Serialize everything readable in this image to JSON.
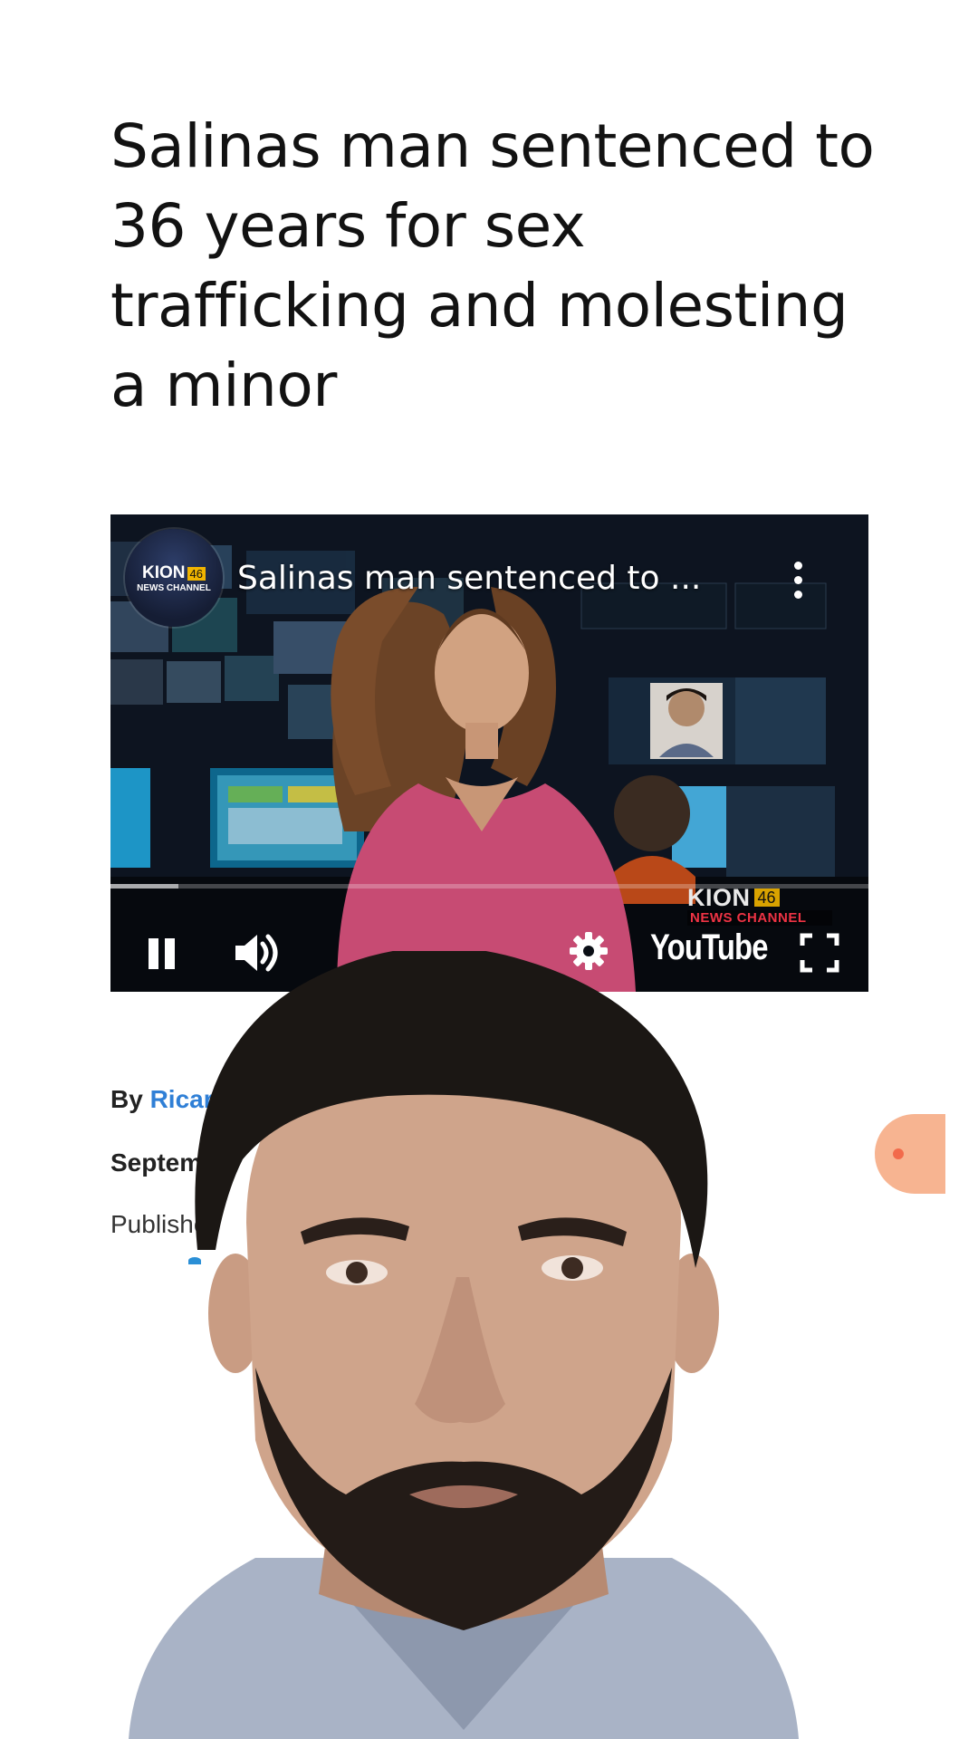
{
  "article": {
    "headline": "Salinas man sentenced to 36 years for sex trafficking and molesting a minor",
    "byline_prefix": "By",
    "author_partial": "Ricar",
    "date_partial": "Septemb",
    "published_partial": "Publishe"
  },
  "video": {
    "channel_name": "KION",
    "channel_number": "46",
    "channel_sub": "NEWS CHANNEL",
    "title": "Salinas man sentenced to ...",
    "platform": "YouTube",
    "progress": 0.09,
    "watermark_name": "KION",
    "watermark_number": "46",
    "watermark_sub": "NEWS CHANNEL"
  },
  "colors": {
    "link": "#2f7fd6",
    "float_button": "#f7b491",
    "float_dot": "#f26a4b",
    "anchor_top": "#e05b7c"
  },
  "icons": [
    "more-vert-icon",
    "pause-icon",
    "volume-icon",
    "gear-icon",
    "fullscreen-icon"
  ]
}
